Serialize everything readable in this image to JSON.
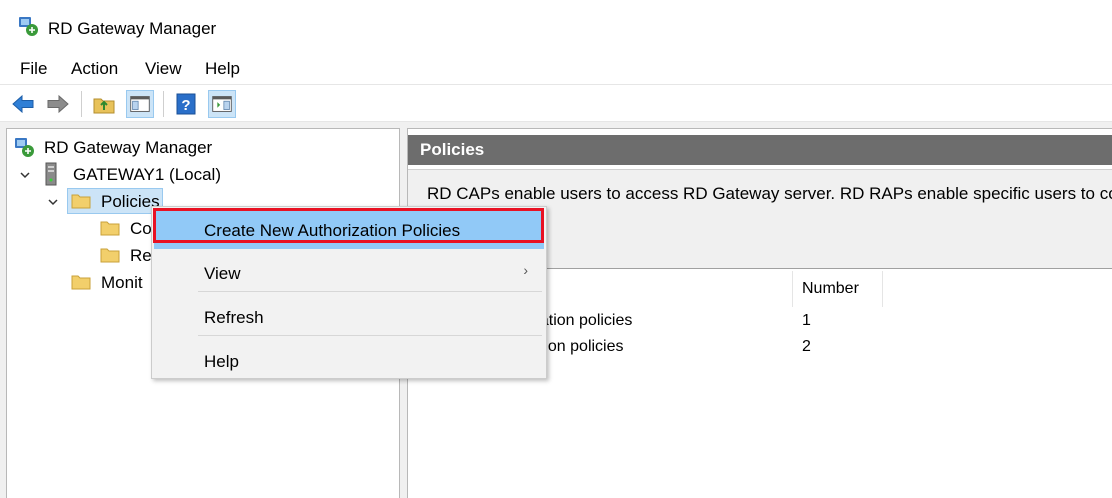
{
  "window": {
    "title": "RD Gateway Manager"
  },
  "menu": [
    "File",
    "Action",
    "View",
    "Help"
  ],
  "toolbar": {
    "buttons": [
      "back-arrow-icon",
      "forward-arrow-icon",
      "up-folder-icon",
      "show-hide-tree-icon",
      "help-icon",
      "show-hide-action-pane-icon"
    ]
  },
  "tree": {
    "root": "RD Gateway Manager",
    "server": "GATEWAY1 (Local)",
    "policies": "Policies",
    "child1": "Co",
    "child2": "Re",
    "monitoring": "Monit"
  },
  "panel": {
    "header": "Policies",
    "description": "RD CAPs enable users to access RD Gateway server. RD RAPs enable specific users to connec",
    "column_number": "Number",
    "rows": [
      {
        "name": "rization policies",
        "number": "1"
      },
      {
        "name": "zation policies",
        "number": "2"
      }
    ]
  },
  "context_menu": {
    "items": [
      "Create New Authorization Policies",
      "View",
      "Refresh",
      "Help"
    ],
    "highlighted": "Create New Authorization Policies"
  },
  "colors": {
    "highlight": "#91c9f7",
    "annotation_border": "#e81123",
    "panel_header": "#6d6d6d"
  }
}
